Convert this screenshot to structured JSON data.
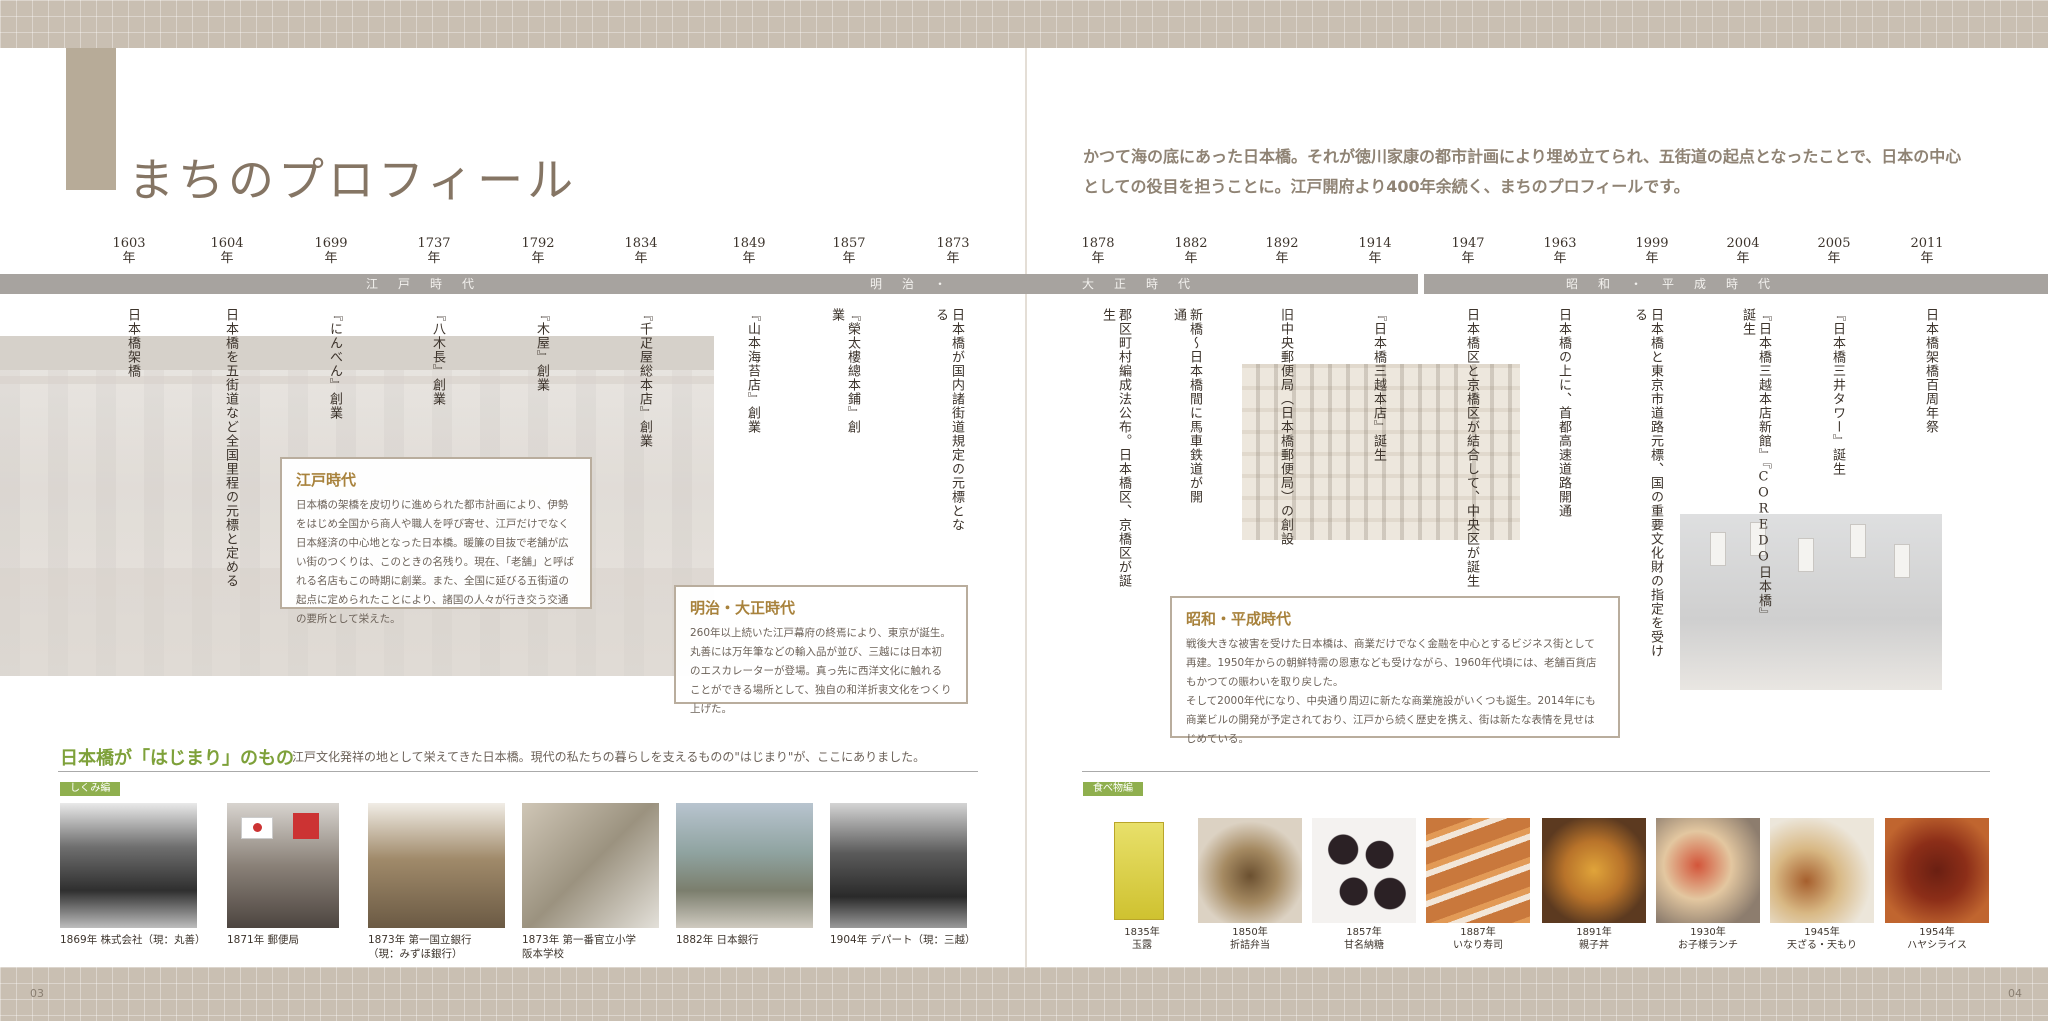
{
  "page": {
    "title": "まちのプロフィール",
    "intro": "かつて海の底にあった日本橋。それが徳川家康の都市計画により埋め立てられ、五街道の起点となったことで、日本の中心としての役目を担うことに。江戸開府より400年余続く、まちのプロフィールです。",
    "page_left": "03",
    "page_right": "04"
  },
  "timeline": {
    "years": [
      "1603\n年",
      "1604\n年",
      "1699\n年",
      "1737\n年",
      "1792\n年",
      "1834\n年",
      "1849\n年",
      "1857\n年",
      "1873\n年",
      "1878\n年",
      "1882\n年",
      "1892\n年",
      "1914\n年",
      "1947\n年",
      "1963\n年",
      "1999\n年",
      "2004\n年",
      "2005\n年",
      "2011\n年"
    ],
    "eras": {
      "edo": "江戸時代",
      "meiji": "明治・",
      "taisho": "大正時代",
      "showa": "昭和・平成時代"
    },
    "events": [
      "日本橋架橋",
      "日本橋を五街道など全国里程の元標と定める",
      "『にんべん』創業",
      "『八木長』創業",
      "『木屋』創業",
      "『千疋屋総本店』創業",
      "『山本海苔店』創業",
      "『榮太樓總本鋪』創業",
      "日本橋が国内諸街道規定の元標となる",
      "郡区町村編成法公布。日本橋区、京橋区が誕生",
      "新橋〜日本橋間に馬車鉄道が開通",
      "旧中央郵便局（日本橋郵便局）の創設",
      "『日本橋三越本店』誕生",
      "日本橋区と京橋区が結合して、中央区が誕生",
      "日本橋の上に、首都高速道路開通",
      "日本橋と東京市道路元標、国の重要文化財の指定を受ける",
      "『日本橋三越本店新館』『COREDO日本橋』誕生",
      "『日本橋三井タワー』誕生",
      "日本橋架橋百周年祭"
    ]
  },
  "era_boxes": {
    "edo": {
      "title": "江戸時代",
      "text": "日本橋の架橋を皮切りに進められた都市計画により、伊勢をはじめ全国から商人や職人を呼び寄せ、江戸だけでなく日本経済の中心地となった日本橋。暖簾の目抜で老舗が広い街のつくりは、このときの名残り。現在、「老舗」と呼ばれる名店もこの時期に創業。また、全国に延びる五街道の起点に定められたことにより、諸国の人々が行き交う交通の要所として栄えた。"
    },
    "meiji": {
      "title": "明治・大正時代",
      "text": "260年以上続いた江戸幕府の終焉により、東京が誕生。丸善には万年筆などの輸入品が並び、三越には日本初のエスカレーターが登場。真っ先に西洋文化に触れることができる場所として、独自の和洋折衷文化をつくり上げた。"
    },
    "showa": {
      "title": "昭和・平成時代",
      "text1": "戦後大きな被害を受けた日本橋は、商業だけでなく金融を中心とするビジネス街として再建。1950年からの朝鮮特需の恩恵なども受けながら、1960年代頃には、老舗百貨店もかつての賑わいを取り戻した。",
      "text2": "そして2000年代になり、中央通り周辺に新たな商業施設がいくつも誕生。2014年にも商業ビルの開発が予定されており、江戸から続く歴史を携え、街は新たな表情を見せはじめている。"
    }
  },
  "origins": {
    "title": "日本橋が「はじまり」のもの",
    "subtitle": "江戸文化発祥の地として栄えてきた日本橋。現代の私たちの暮らしを支えるものの\"はじまり\"が、ここにありました。",
    "shikumi_tag": "しくみ編",
    "food_tag": "食べ物編",
    "shikumi": [
      {
        "caption": "1869年 株式会社（現：丸善）"
      },
      {
        "caption": "1871年 郵便局"
      },
      {
        "caption": "1873年 第一国立銀行\n（現：みずほ銀行）"
      },
      {
        "caption": "1873年 第一番官立小学\n阪本学校"
      },
      {
        "caption": "1882年 日本銀行"
      },
      {
        "caption": "1904年 デパート（現：三越）"
      }
    ],
    "food": [
      {
        "year": "1835年",
        "name": "玉露"
      },
      {
        "year": "1850年",
        "name": "折詰弁当"
      },
      {
        "year": "1857年",
        "name": "甘名納糖"
      },
      {
        "year": "1887年",
        "name": "いなり寿司"
      },
      {
        "year": "1891年",
        "name": "親子丼"
      },
      {
        "year": "1930年",
        "name": "お子様ランチ"
      },
      {
        "year": "1945年",
        "name": "天ざる・天もり"
      },
      {
        "year": "1954年",
        "name": "ハヤシライス"
      }
    ]
  },
  "colors": {
    "accent_brown": "#b7ab98",
    "accent_green": "#8faf4e",
    "era_bar": "#a7a39f",
    "box_title": "#a8823c"
  },
  "icons": []
}
